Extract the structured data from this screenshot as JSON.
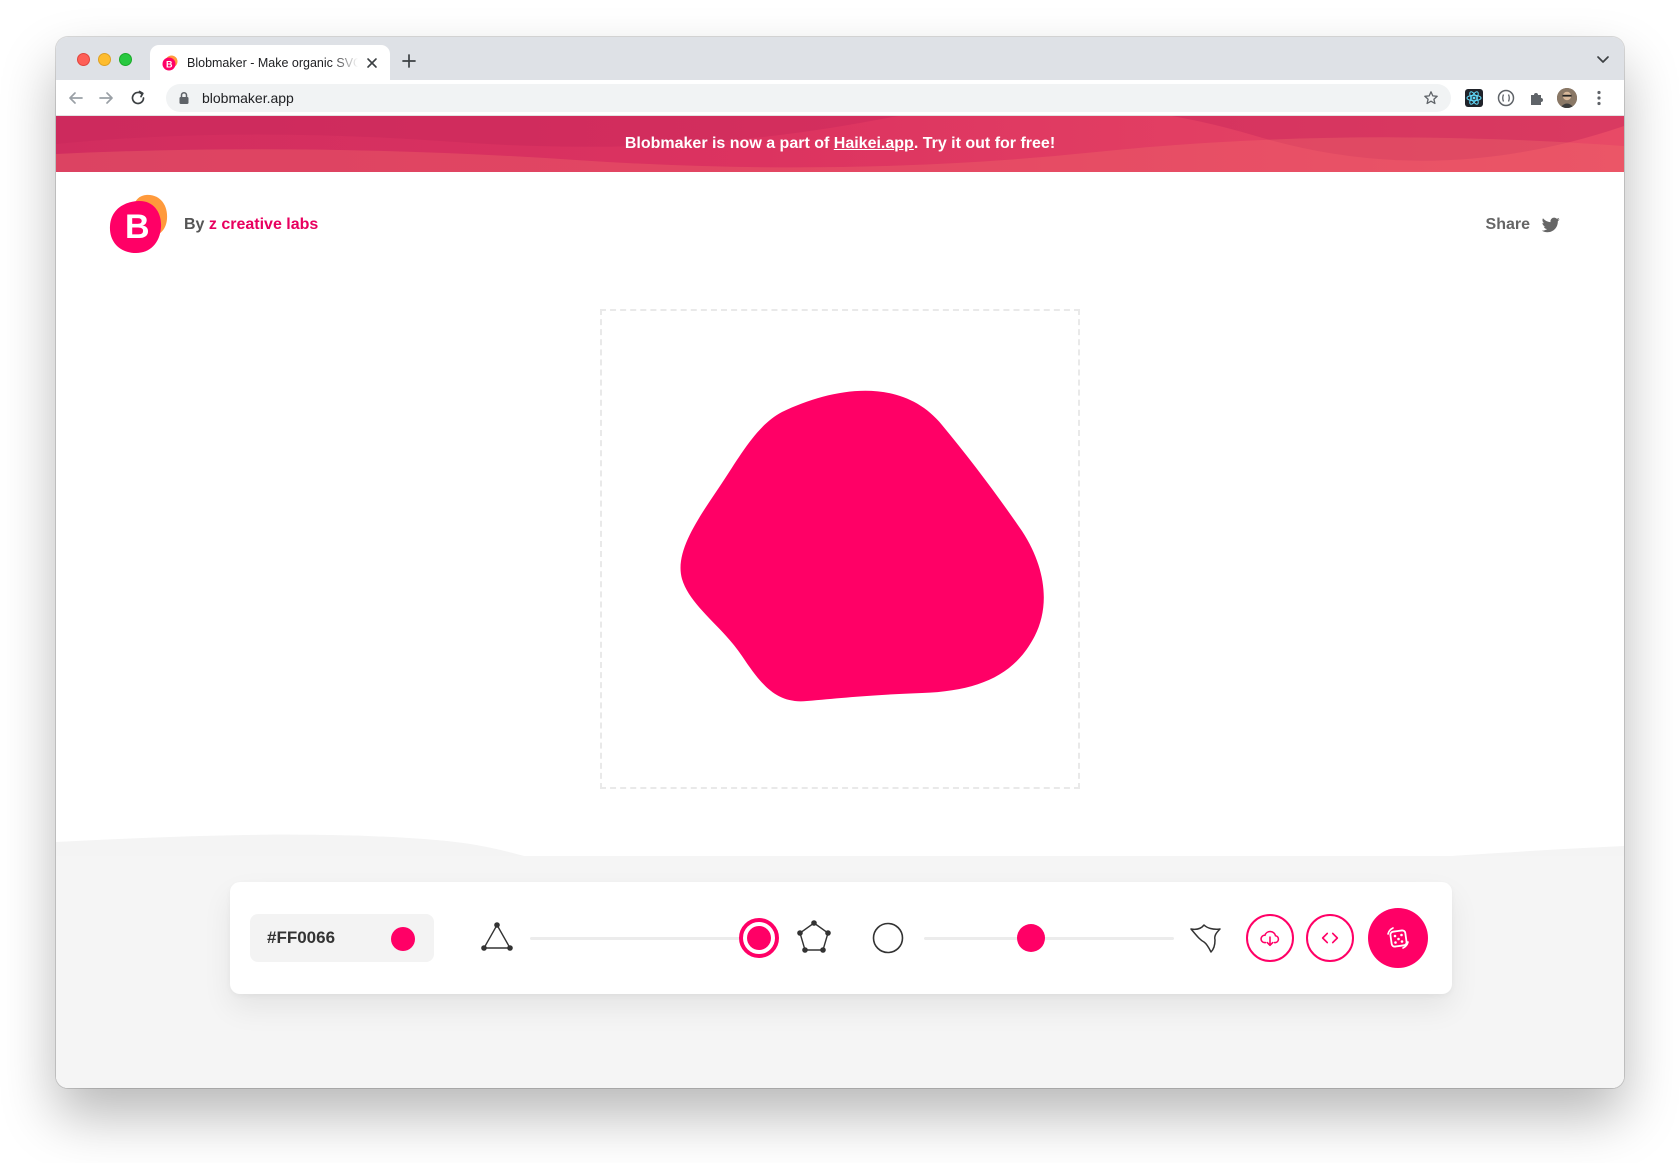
{
  "browser": {
    "tab_title": "Blobmaker - Make organic SVG shapes",
    "url": "blobmaker.app"
  },
  "banner": {
    "text_before": "Blobmaker is now a part of ",
    "link_text": "Haikei.app",
    "text_after": ". Try it out for free!"
  },
  "header": {
    "by_label": "By",
    "brand_name": "z creative labs",
    "share_label": "Share"
  },
  "blob": {
    "fill_color": "#FF0066"
  },
  "controls": {
    "color_hex": "#FF0066",
    "complexity_level": 1.0,
    "contrast_level": 0.45
  },
  "colors": {
    "accent": "#ff0066",
    "banner_start": "#d12d5f",
    "banner_end": "#e84a66"
  },
  "icons": {
    "triangle": "triangle-nodes-icon",
    "pentagon": "pentagon-nodes-icon",
    "circle": "circle-outline-icon",
    "spiky": "spiky-shape-icon",
    "download": "cloud-download-icon",
    "code": "code-brackets-icon",
    "random": "dice-random-icon",
    "twitter": "twitter-icon"
  }
}
